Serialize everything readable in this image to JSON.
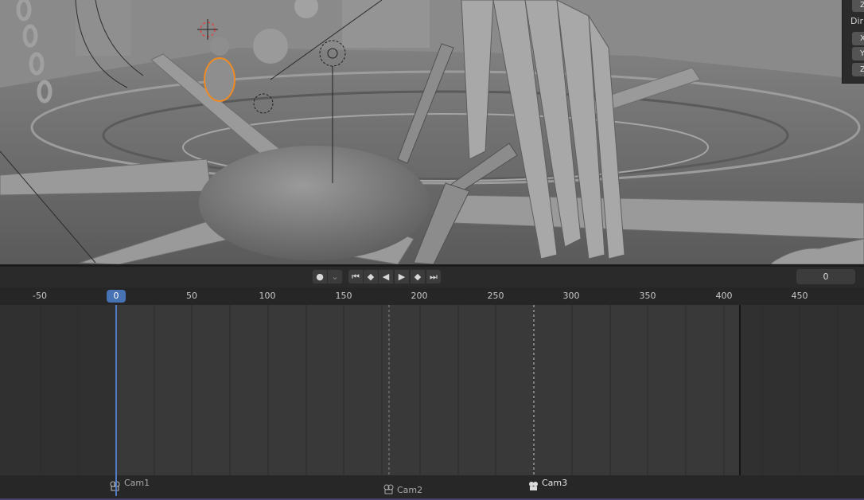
{
  "viewport": {
    "panel_label": "Dir",
    "panel_axes": [
      "Z",
      "X",
      "Y",
      "Z"
    ]
  },
  "timeline": {
    "current_frame": "0",
    "frame_field_value": "0",
    "transport": {
      "record": "●",
      "record_menu": "⌄",
      "jump_start": "⏮",
      "prev_keyframe": "◆",
      "play_reverse": "◀",
      "play": "▶",
      "next_keyframe": "◆",
      "jump_end": "⏭"
    },
    "ruler_ticks": [
      "-50",
      "50",
      "100",
      "150",
      "200",
      "250",
      "300",
      "350",
      "400",
      "450"
    ],
    "markers": [
      {
        "label": "Cam1",
        "frame": 0
      },
      {
        "label": "Cam2",
        "frame": 180
      },
      {
        "label": "Cam3",
        "frame": 275
      }
    ],
    "frame_start": -50,
    "frame_end": 410
  },
  "colors": {
    "accent": "#4772b3",
    "selection": "#f08a24"
  }
}
